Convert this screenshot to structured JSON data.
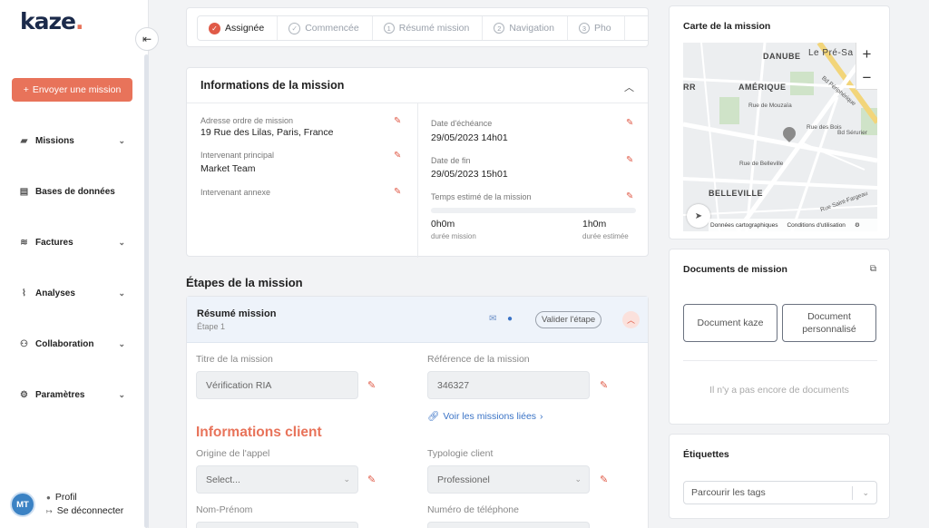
{
  "app": {
    "logo": "kaze",
    "logo_dot": "."
  },
  "sidebar": {
    "send_button": "Envoyer une mission",
    "items": [
      {
        "label": "Missions",
        "icon": "briefcase-icon",
        "has_chevron": true
      },
      {
        "label": "Bases de données",
        "icon": "folders-icon",
        "has_chevron": false
      },
      {
        "label": "Factures",
        "icon": "coins-icon",
        "has_chevron": true
      },
      {
        "label": "Analyses",
        "icon": "chart-line-icon",
        "has_chevron": true
      },
      {
        "label": "Collaboration",
        "icon": "users-icon",
        "has_chevron": true
      },
      {
        "label": "Paramètres",
        "icon": "gear-icon",
        "has_chevron": true
      }
    ],
    "user": {
      "initials": "MT",
      "profile": "Profil",
      "logout": "Se déconnecter"
    }
  },
  "stepper": {
    "steps": [
      {
        "label": "Assignée",
        "state": "done"
      },
      {
        "label": "Commencée",
        "state": "pending"
      },
      {
        "label": "Résumé mission",
        "number": "1"
      },
      {
        "label": "Navigation",
        "number": "2"
      },
      {
        "label": "Pho",
        "number": "3"
      }
    ]
  },
  "info": {
    "title": "Informations de la mission",
    "left": [
      {
        "label": "Adresse ordre de mission",
        "value": "19 Rue des Lilas, Paris, France"
      },
      {
        "label": "Intervenant principal",
        "value": "Market Team"
      },
      {
        "label": "Intervenant annexe",
        "value": ""
      }
    ],
    "right": [
      {
        "label": "Date d'échéance",
        "value": "29/05/2023 14h01"
      },
      {
        "label": "Date de fin",
        "value": "29/05/2023 15h01"
      },
      {
        "label": "Temps estimé de la mission",
        "value": ""
      }
    ],
    "duration": {
      "value": "0h0m",
      "label": "durée mission"
    },
    "estimated": {
      "value": "1h0m",
      "label": "durée estimée"
    },
    "progress": 0
  },
  "etapes": {
    "section_title": "Étapes de la mission",
    "current": {
      "title": "Résumé mission",
      "subtitle": "Étape 1",
      "validate": "Valider l'étape"
    },
    "fields": {
      "titre_label": "Titre de la mission",
      "titre_value": "Vérification RIA",
      "ref_label": "Référence de la mission",
      "ref_value": "346327",
      "link_lies": "Voir les missions liées",
      "client_title": "Informations client",
      "origine_label": "Origine de l'appel",
      "origine_value": "Select...",
      "typologie_label": "Typologie client",
      "typologie_value": "Professionel",
      "nom_label": "Nom-Prénom",
      "tel_label": "Numéro de téléphone"
    }
  },
  "map": {
    "title": "Carte de la mission",
    "labels": {
      "danube": "DANUBE",
      "pre": "Le Pré-Sa",
      "amerique": "AMÉRIQUE",
      "belleville": "BELLEVILLE",
      "rr": "RR",
      "mouzaia": "Rue de Mouzaïa",
      "periph": "Bd Périphérique",
      "bois": "Rue des Bois",
      "serurier": "Bd Sérurier",
      "belleville_rue": "Rue de Belleville",
      "fargeau": "Rue Saint-Fargeau"
    },
    "footer": {
      "data": "Données cartographiques",
      "terms": "Conditions d'utilisation"
    }
  },
  "documents": {
    "title": "Documents de mission",
    "buttons": [
      "Document kaze",
      "Document personnalisé"
    ],
    "empty": "Il n'y a pas encore de documents"
  },
  "tags": {
    "title": "Étiquettes",
    "placeholder": "Parcourir les tags"
  },
  "colors": {
    "accent": "#e8735a",
    "danger": "#e05a47",
    "link": "#3a73c6"
  }
}
